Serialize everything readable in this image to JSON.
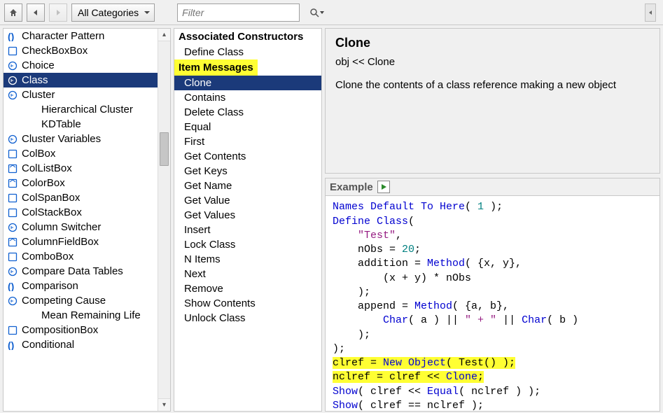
{
  "toolbar": {
    "category_combo": "All Categories",
    "filter_placeholder": "Filter"
  },
  "left_tree": [
    {
      "icon": "paren",
      "label": "Character Pattern",
      "indent": 0
    },
    {
      "icon": "box",
      "label": "CheckBoxBox",
      "indent": 0
    },
    {
      "icon": "circle",
      "label": "Choice",
      "indent": 0
    },
    {
      "icon": "circle",
      "label": "Class",
      "indent": 0,
      "selected": true
    },
    {
      "icon": "circle",
      "label": "Cluster",
      "indent": 0
    },
    {
      "icon": "none",
      "label": "Hierarchical Cluster",
      "indent": 1
    },
    {
      "icon": "none",
      "label": "KDTable",
      "indent": 1
    },
    {
      "icon": "circle",
      "label": "Cluster Variables",
      "indent": 0
    },
    {
      "icon": "box",
      "label": "ColBox",
      "indent": 0
    },
    {
      "icon": "box-a",
      "label": "ColListBox",
      "indent": 0
    },
    {
      "icon": "box-a",
      "label": "ColorBox",
      "indent": 0
    },
    {
      "icon": "box",
      "label": "ColSpanBox",
      "indent": 0
    },
    {
      "icon": "box",
      "label": "ColStackBox",
      "indent": 0
    },
    {
      "icon": "circle",
      "label": "Column Switcher",
      "indent": 0
    },
    {
      "icon": "box-a",
      "label": "ColumnFieldBox",
      "indent": 0
    },
    {
      "icon": "box",
      "label": "ComboBox",
      "indent": 0
    },
    {
      "icon": "circle",
      "label": "Compare Data Tables",
      "indent": 0
    },
    {
      "icon": "paren",
      "label": "Comparison",
      "indent": 0
    },
    {
      "icon": "circle",
      "label": "Competing Cause",
      "indent": 0
    },
    {
      "icon": "none",
      "label": "Mean Remaining Life",
      "indent": 1
    },
    {
      "icon": "box",
      "label": "CompositionBox",
      "indent": 0
    },
    {
      "icon": "paren",
      "label": "Conditional",
      "indent": 0
    }
  ],
  "mid_panel": {
    "section1_title": "Associated Constructors",
    "section1_items": [
      "Define Class"
    ],
    "section2_title": "Item Messages",
    "section2_items": [
      "Clone",
      "Contains",
      "Delete Class",
      "Equal",
      "First",
      "Get Contents",
      "Get Keys",
      "Get Name",
      "Get Value",
      "Get Values",
      "Insert",
      "Lock Class",
      "N Items",
      "Next",
      "Remove",
      "Show Contents",
      "Unlock Class"
    ],
    "selected_item": "Clone"
  },
  "right": {
    "title": "Clone",
    "signature": "obj << Clone",
    "description": "Clone the contents of a class reference making a new object",
    "example_label": "Example"
  },
  "code_tokens": [
    [
      [
        "kw",
        "Names Default To Here"
      ],
      [
        "",
        "( "
      ],
      [
        "num",
        "1"
      ],
      [
        "",
        " );"
      ]
    ],
    [
      [
        "kw",
        "Define Class"
      ],
      [
        "",
        "("
      ]
    ],
    [
      [
        "",
        "    "
      ],
      [
        "str",
        "\"Test\""
      ],
      [
        "",
        ","
      ]
    ],
    [
      [
        "",
        "    nObs = "
      ],
      [
        "num",
        "20"
      ],
      [
        "",
        ";"
      ]
    ],
    [
      [
        "",
        "    addition = "
      ],
      [
        "kw",
        "Method"
      ],
      [
        "",
        "( {x, y},"
      ]
    ],
    [
      [
        "",
        "        (x + y) * nObs"
      ]
    ],
    [
      [
        "",
        "    );"
      ]
    ],
    [
      [
        "",
        "    append = "
      ],
      [
        "kw",
        "Method"
      ],
      [
        "",
        "( {a, b},"
      ]
    ],
    [
      [
        "",
        "        "
      ],
      [
        "kw",
        "Char"
      ],
      [
        "",
        "( a ) || "
      ],
      [
        "str",
        "\" + \""
      ],
      [
        "",
        " || "
      ],
      [
        "kw",
        "Char"
      ],
      [
        "",
        "( b )"
      ]
    ],
    [
      [
        "",
        "    );"
      ]
    ],
    [
      [
        "",
        ");"
      ]
    ],
    [
      [
        "",
        "clref = "
      ],
      [
        "kw",
        "New Object"
      ],
      [
        "",
        "( Test() );"
      ]
    ],
    [
      [
        "",
        "nclref = clref << "
      ],
      [
        "kw",
        "Clone"
      ],
      [
        "",
        ";"
      ]
    ],
    [
      [
        "kw",
        "Show"
      ],
      [
        "",
        "( clref << "
      ],
      [
        "kw",
        "Equal"
      ],
      [
        "",
        "( nclref ) );"
      ]
    ],
    [
      [
        "kw",
        "Show"
      ],
      [
        "",
        "( clref == nclref );"
      ]
    ]
  ],
  "highlighted_lines": [
    11,
    12
  ],
  "icons": {
    "paren_color": "#1060d0",
    "box_color": "#1060d0",
    "circle_color": "#1060d0"
  }
}
